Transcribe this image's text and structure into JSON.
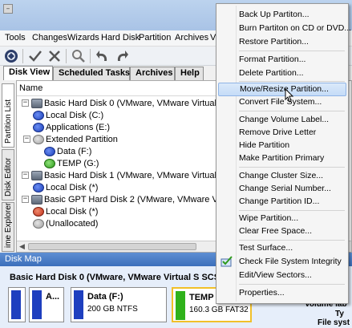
{
  "window": {
    "control_glyph": "–"
  },
  "menubar": {
    "items": [
      "Tools",
      "Changes",
      "Wizards",
      "Hard Disk",
      "Partition",
      "Archives",
      "Vi"
    ]
  },
  "toolbar": {
    "icons": [
      "disk-icon",
      "checkmark-icon",
      "cross-icon",
      "search-icon",
      "undo-icon",
      "redo-icon"
    ]
  },
  "tabs": [
    {
      "label": "Disk View",
      "active": true
    },
    {
      "label": "Scheduled Tasks",
      "active": false
    },
    {
      "label": "Archives",
      "active": false
    },
    {
      "label": "Help",
      "active": false
    }
  ],
  "side_tabs": [
    {
      "label": "Partition List",
      "active": true
    },
    {
      "label": "Disk Editor",
      "active": false
    },
    {
      "label": "ime Explorer",
      "active": false
    }
  ],
  "tree": {
    "column_header": "Name",
    "rows": [
      {
        "text": "Basic Hard Disk 0 (VMware, VMware Virtual S SCSI Disk Dev",
        "icon": "hard-disk-icon",
        "level": 0,
        "expander": "−"
      },
      {
        "text": "Local Disk (C:)",
        "icon": "blue-partition-icon",
        "level": 1
      },
      {
        "text": "Applications (E:)",
        "icon": "blue-partition-icon",
        "level": 1
      },
      {
        "text": "Extended Partition",
        "icon": "gray-partition-icon",
        "level": 1,
        "expander": "−"
      },
      {
        "text": "Data (F:)",
        "icon": "blue-partition-icon",
        "level": 2
      },
      {
        "text": "TEMP (G:)",
        "icon": "green-partition-icon",
        "level": 2
      },
      {
        "text": "Basic Hard Disk 1 (VMware, VMware Virtual S SCSI Disk Dev",
        "icon": "hard-disk-icon",
        "level": 0,
        "expander": "−"
      },
      {
        "text": "Local Disk (*)",
        "icon": "blue-partition-icon",
        "level": 1
      },
      {
        "text": "Basic GPT Hard Disk 2 (VMware, VMware Virtual S SCSI Disk",
        "icon": "hard-disk-icon",
        "level": 0,
        "expander": "−"
      },
      {
        "text": "Local Disk (*)",
        "icon": "red-partition-icon",
        "level": 1
      },
      {
        "text": "(Unallocated)",
        "icon": "gray-partition-icon",
        "level": 1
      }
    ]
  },
  "disk_map": {
    "header": "Disk Map",
    "disk_title": "Basic Hard Disk 0 (VMware, VMware Virtual S SCSI Disk",
    "blocks": [
      {
        "label": "",
        "sub": "",
        "color": "#1e3fbf"
      },
      {
        "label": "A...",
        "sub": "",
        "color": "#1e3fbf"
      },
      {
        "label": "Data (F:)",
        "sub": "200 GB NTFS",
        "color": "#1e3fbf"
      },
      {
        "label": "TEMP",
        "sub": "160.3 GB FAT32",
        "color": "#2fb21b"
      }
    ],
    "right_info": [
      "Volume lab",
      "Ty",
      "File syst"
    ]
  },
  "context_menu": {
    "groups": [
      [
        {
          "label": "Back Up Partiton...",
          "icon": null
        },
        {
          "label": "Burn Partiton on CD or DVD...",
          "icon": null
        },
        {
          "label": "Restore Partition...",
          "icon": null
        }
      ],
      [
        {
          "label": "Format Partition...",
          "icon": null
        },
        {
          "label": "Delete Partition...",
          "icon": null
        }
      ],
      [
        {
          "label": "Move/Resize Partition...",
          "icon": null,
          "highlighted": true
        },
        {
          "label": "Convert File System...",
          "icon": null
        }
      ],
      [
        {
          "label": "Change Volume Label...",
          "icon": null
        },
        {
          "label": "Remove Drive Letter",
          "icon": null
        },
        {
          "label": "Hide Partition",
          "icon": null
        },
        {
          "label": "Make Partition Primary",
          "icon": null
        }
      ],
      [
        {
          "label": "Change Cluster Size...",
          "icon": null
        },
        {
          "label": "Change Serial Number...",
          "icon": null
        },
        {
          "label": "Change Partition ID...",
          "icon": null
        }
      ],
      [
        {
          "label": "Wipe Partition...",
          "icon": null
        },
        {
          "label": "Clear Free Space...",
          "icon": null
        }
      ],
      [
        {
          "label": "Test Surface...",
          "icon": null
        },
        {
          "label": "Check File System Integrity",
          "icon": "check-filesystem-icon"
        },
        {
          "label": "Edit/View Sectors...",
          "icon": null
        }
      ],
      [
        {
          "label": "Properties...",
          "icon": null
        }
      ]
    ]
  },
  "colors": {
    "highlight": "#c5dcf7",
    "disk_map_header": "#3c6fbb",
    "ntfs_blue": "#1e3fbf",
    "fat32_green": "#2fb21b"
  }
}
